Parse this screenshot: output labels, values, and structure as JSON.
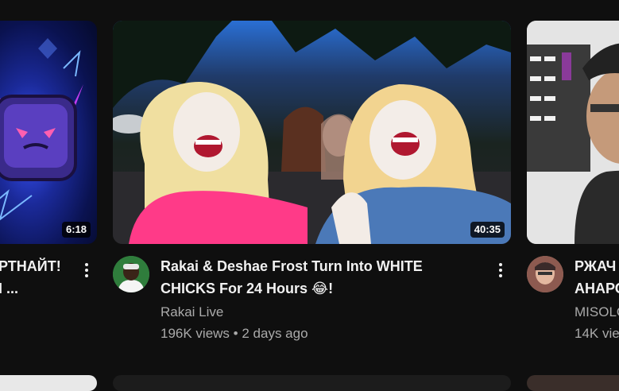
{
  "left_card": {
    "duration": "6:18",
    "title_line1": "РТНАЙТ!",
    "title_line2": "I ..."
  },
  "main_card": {
    "duration": "40:35",
    "title_line1": "Rakai & Deshae Frost Turn Into WHITE",
    "title_line2": "CHICKS For 24 Hours",
    "title_emoji": "😂",
    "title_end": "!",
    "channel": "Rakai Live",
    "views": "196K views",
    "separator": "•",
    "age": "2 days ago"
  },
  "right_card": {
    "title_line1": "РЖАЧ",
    "title_line2": "АНАРО",
    "channel": "MISOLO",
    "views": "14K vie"
  }
}
